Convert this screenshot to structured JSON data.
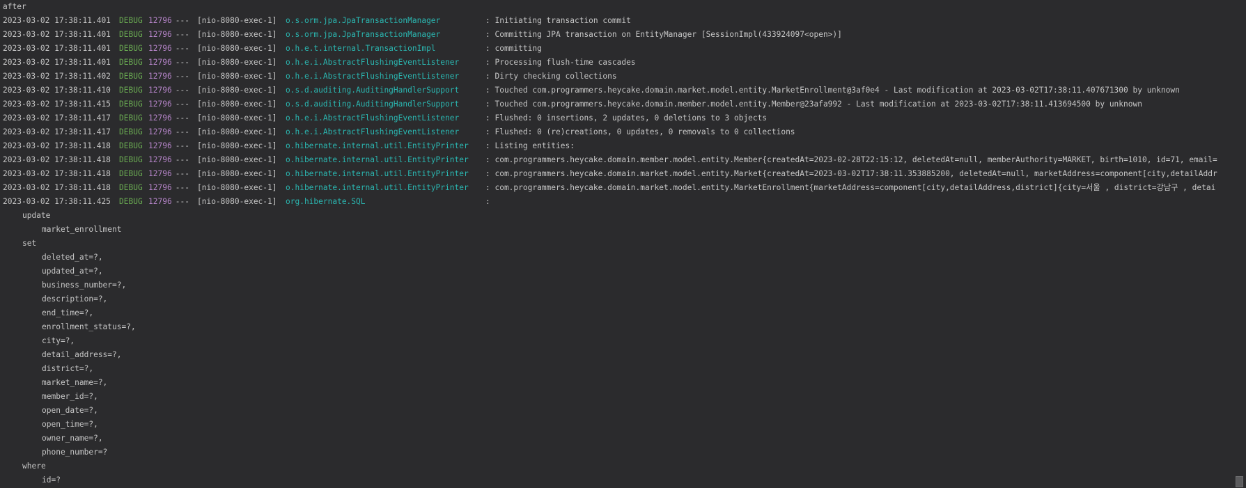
{
  "header": "after",
  "log_entries": [
    {
      "ts": "2023-03-02 17:38:11.401",
      "level": "DEBUG",
      "pid": "12796",
      "sep": " --- ",
      "thread": "[nio-8080-exec-1]",
      "logger": "o.s.orm.jpa.JpaTransactionManager",
      "msg": ": Initiating transaction commit"
    },
    {
      "ts": "2023-03-02 17:38:11.401",
      "level": "DEBUG",
      "pid": "12796",
      "sep": " --- ",
      "thread": "[nio-8080-exec-1]",
      "logger": "o.s.orm.jpa.JpaTransactionManager",
      "msg": ": Committing JPA transaction on EntityManager [SessionImpl(433924097<open>)]"
    },
    {
      "ts": "2023-03-02 17:38:11.401",
      "level": "DEBUG",
      "pid": "12796",
      "sep": " --- ",
      "thread": "[nio-8080-exec-1]",
      "logger": "o.h.e.t.internal.TransactionImpl",
      "msg": ": committing"
    },
    {
      "ts": "2023-03-02 17:38:11.401",
      "level": "DEBUG",
      "pid": "12796",
      "sep": " --- ",
      "thread": "[nio-8080-exec-1]",
      "logger": "o.h.e.i.AbstractFlushingEventListener",
      "msg": ": Processing flush-time cascades"
    },
    {
      "ts": "2023-03-02 17:38:11.402",
      "level": "DEBUG",
      "pid": "12796",
      "sep": " --- ",
      "thread": "[nio-8080-exec-1]",
      "logger": "o.h.e.i.AbstractFlushingEventListener",
      "msg": ": Dirty checking collections"
    },
    {
      "ts": "2023-03-02 17:38:11.410",
      "level": "DEBUG",
      "pid": "12796",
      "sep": " --- ",
      "thread": "[nio-8080-exec-1]",
      "logger": "o.s.d.auditing.AuditingHandlerSupport",
      "msg": ": Touched com.programmers.heycake.domain.market.model.entity.MarketEnrollment@3af0e4 - Last modification at 2023-03-02T17:38:11.407671300 by unknown"
    },
    {
      "ts": "2023-03-02 17:38:11.415",
      "level": "DEBUG",
      "pid": "12796",
      "sep": " --- ",
      "thread": "[nio-8080-exec-1]",
      "logger": "o.s.d.auditing.AuditingHandlerSupport",
      "msg": ": Touched com.programmers.heycake.domain.member.model.entity.Member@23afa992 - Last modification at 2023-03-02T17:38:11.413694500 by unknown"
    },
    {
      "ts": "2023-03-02 17:38:11.417",
      "level": "DEBUG",
      "pid": "12796",
      "sep": " --- ",
      "thread": "[nio-8080-exec-1]",
      "logger": "o.h.e.i.AbstractFlushingEventListener",
      "msg": ": Flushed: 0 insertions, 2 updates, 0 deletions to 3 objects"
    },
    {
      "ts": "2023-03-02 17:38:11.417",
      "level": "DEBUG",
      "pid": "12796",
      "sep": " --- ",
      "thread": "[nio-8080-exec-1]",
      "logger": "o.h.e.i.AbstractFlushingEventListener",
      "msg": ": Flushed: 0 (re)creations, 0 updates, 0 removals to 0 collections"
    },
    {
      "ts": "2023-03-02 17:38:11.418",
      "level": "DEBUG",
      "pid": "12796",
      "sep": " --- ",
      "thread": "[nio-8080-exec-1]",
      "logger": "o.hibernate.internal.util.EntityPrinter",
      "msg": ": Listing entities:"
    },
    {
      "ts": "2023-03-02 17:38:11.418",
      "level": "DEBUG",
      "pid": "12796",
      "sep": " --- ",
      "thread": "[nio-8080-exec-1]",
      "logger": "o.hibernate.internal.util.EntityPrinter",
      "msg": ": com.programmers.heycake.domain.member.model.entity.Member{createdAt=2023-02-28T22:15:12, deletedAt=null, memberAuthority=MARKET, birth=1010, id=71, email="
    },
    {
      "ts": "2023-03-02 17:38:11.418",
      "level": "DEBUG",
      "pid": "12796",
      "sep": " --- ",
      "thread": "[nio-8080-exec-1]",
      "logger": "o.hibernate.internal.util.EntityPrinter",
      "msg": ": com.programmers.heycake.domain.market.model.entity.Market{createdAt=2023-03-02T17:38:11.353885200, deletedAt=null, marketAddress=component[city,detailAddr"
    },
    {
      "ts": "2023-03-02 17:38:11.418",
      "level": "DEBUG",
      "pid": "12796",
      "sep": " --- ",
      "thread": "[nio-8080-exec-1]",
      "logger": "o.hibernate.internal.util.EntityPrinter",
      "msg": ": com.programmers.heycake.domain.market.model.entity.MarketEnrollment{marketAddress=component[city,detailAddress,district]{city=서울 , district=강남구 , detai"
    },
    {
      "ts": "2023-03-02 17:38:11.425",
      "level": "DEBUG",
      "pid": "12796",
      "sep": " --- ",
      "thread": "[nio-8080-exec-1]",
      "logger": "org.hibernate.SQL",
      "msg": ":"
    }
  ],
  "sql_lines": [
    {
      "indent": 1,
      "text": "update"
    },
    {
      "indent": 2,
      "text": "market_enrollment"
    },
    {
      "indent": 1,
      "text": "set"
    },
    {
      "indent": 2,
      "text": "deleted_at=?,"
    },
    {
      "indent": 2,
      "text": "updated_at=?,"
    },
    {
      "indent": 2,
      "text": "business_number=?,"
    },
    {
      "indent": 2,
      "text": "description=?,"
    },
    {
      "indent": 2,
      "text": "end_time=?,"
    },
    {
      "indent": 2,
      "text": "enrollment_status=?,"
    },
    {
      "indent": 2,
      "text": "city=?,"
    },
    {
      "indent": 2,
      "text": "detail_address=?,"
    },
    {
      "indent": 2,
      "text": "district=?,"
    },
    {
      "indent": 2,
      "text": "market_name=?,"
    },
    {
      "indent": 2,
      "text": "member_id=?,"
    },
    {
      "indent": 2,
      "text": "open_date=?,"
    },
    {
      "indent": 2,
      "text": "open_time=?,"
    },
    {
      "indent": 2,
      "text": "owner_name=?,"
    },
    {
      "indent": 2,
      "text": "phone_number=?"
    },
    {
      "indent": 1,
      "text": "where"
    },
    {
      "indent": 2,
      "text": "id=?"
    }
  ],
  "colors": {
    "background": "#2b2b2d",
    "text": "#c6c6c6",
    "level": "#6aab52",
    "pid": "#b685c9",
    "logger": "#2bb7b1"
  }
}
